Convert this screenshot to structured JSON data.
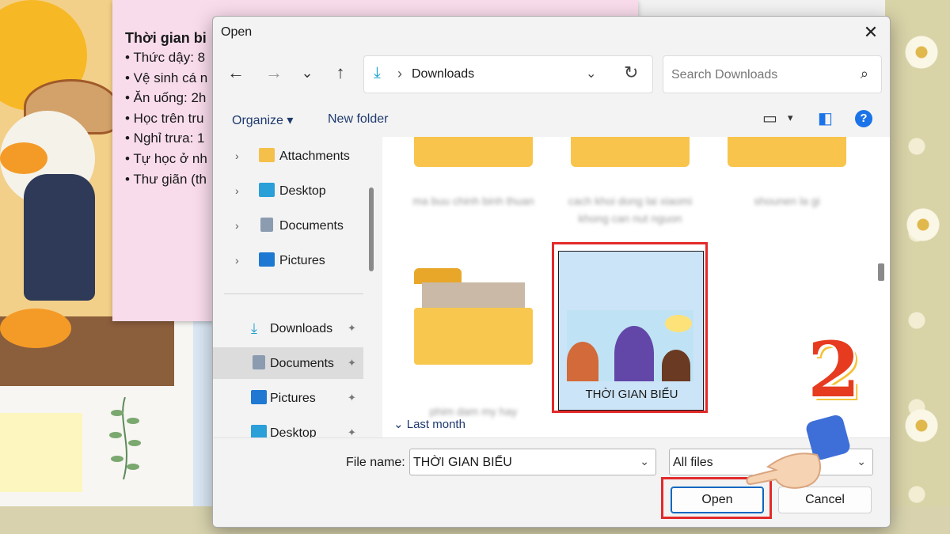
{
  "background": {
    "schedule_title": "Thời gian bi",
    "schedule_items": [
      "• Thức dậy: 8",
      "• Vệ sinh cá n",
      "• Ăn uống: 2h",
      "• Học trên tru",
      "• Nghỉ trưa: 1",
      "• Tự học ở nh",
      "• Thư giãn (th"
    ]
  },
  "dialog": {
    "title": "Open",
    "close_glyph": "✕",
    "nav": {
      "back_glyph": "←",
      "forward_glyph": "→",
      "recent_glyph": "⌄",
      "up_glyph": "↑",
      "address_icon": "download-icon",
      "address_path": "Downloads",
      "address_sep": "›",
      "address_dropdown": "⌄",
      "refresh_glyph": "↻",
      "search_placeholder": "Search Downloads",
      "search_glyph": "⌕"
    },
    "toolbar": {
      "organize": "Organize ▾",
      "new_folder": "New folder",
      "view_glyph": "▭",
      "view_dropdown": "▾",
      "pane_glyph": "◧",
      "help_glyph": "?"
    },
    "nav_pane": {
      "tree": [
        {
          "label": "Attachments",
          "icon": "folder-icon",
          "color": "#f5c04a"
        },
        {
          "label": "Desktop",
          "icon": "desktop-icon",
          "color": "#2a9fd8"
        },
        {
          "label": "Documents",
          "icon": "documents-icon",
          "color": "#8b9bb0"
        },
        {
          "label": "Pictures",
          "icon": "pictures-icon",
          "color": "#1f78d1"
        }
      ],
      "quick_access": [
        {
          "label": "Downloads",
          "icon": "download-icon",
          "color": "#1aa0cf",
          "selected": false
        },
        {
          "label": "Documents",
          "icon": "documents-icon",
          "color": "#8b9bb0",
          "selected": true
        },
        {
          "label": "Pictures",
          "icon": "pictures-icon",
          "color": "#1f78d1",
          "selected": false
        },
        {
          "label": "Desktop",
          "icon": "desktop-icon",
          "color": "#2a9fd8",
          "selected": false
        }
      ],
      "pin_glyph": "📌",
      "chevron_glyph": "›"
    },
    "files": {
      "blurred_names": [
        "ma buu chinh binh thuan",
        "cach khoi dong lai xiaomi khong can nut nguon",
        "shounen la gi",
        "phim dam my hay"
      ],
      "selected_file": "THỜI GIAN BIỂU",
      "group_header": "⌄  Last month"
    },
    "footer": {
      "file_name_label": "File name:",
      "file_name_value": "THỜI GIAN BIỂU",
      "filter_value": "All files",
      "dropdown_glyph": "⌄",
      "open_label": "Open",
      "cancel_label": "Cancel"
    }
  },
  "annotations": {
    "step_number": "2",
    "highlight_color": "#e32a2a"
  }
}
